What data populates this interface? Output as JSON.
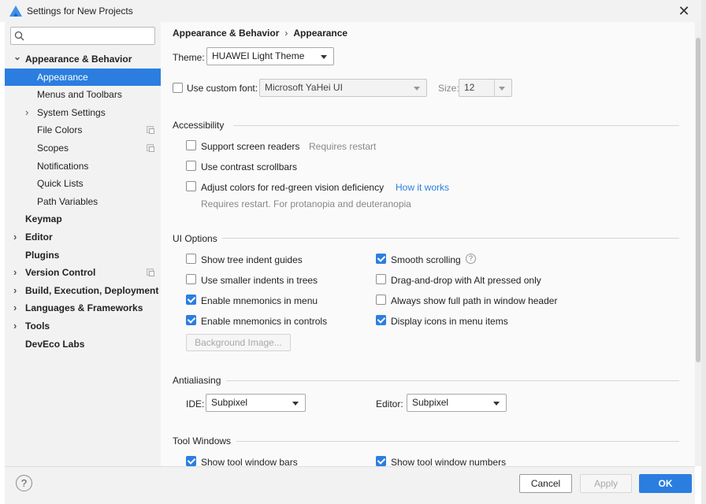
{
  "window": {
    "title": "Settings for New Projects"
  },
  "search": {
    "placeholder": "",
    "value": ""
  },
  "sidebar": {
    "items": [
      {
        "label": "Appearance & Behavior",
        "level": 0,
        "bold": true,
        "expanded": true
      },
      {
        "label": "Appearance",
        "level": 1,
        "selected": true
      },
      {
        "label": "Menus and Toolbars",
        "level": 1
      },
      {
        "label": "System Settings",
        "level": 1,
        "expandable": true
      },
      {
        "label": "File Colors",
        "level": 1,
        "project_icon": true
      },
      {
        "label": "Scopes",
        "level": 1,
        "project_icon": true
      },
      {
        "label": "Notifications",
        "level": 1
      },
      {
        "label": "Quick Lists",
        "level": 1
      },
      {
        "label": "Path Variables",
        "level": 1
      },
      {
        "label": "Keymap",
        "level": 0,
        "bold": true
      },
      {
        "label": "Editor",
        "level": 0,
        "bold": true,
        "expandable": true
      },
      {
        "label": "Plugins",
        "level": 0,
        "bold": true
      },
      {
        "label": "Version Control",
        "level": 0,
        "bold": true,
        "expandable": true,
        "project_icon": true
      },
      {
        "label": "Build, Execution, Deployment",
        "level": 0,
        "bold": true,
        "expandable": true
      },
      {
        "label": "Languages & Frameworks",
        "level": 0,
        "bold": true,
        "expandable": true
      },
      {
        "label": "Tools",
        "level": 0,
        "bold": true,
        "expandable": true
      },
      {
        "label": "DevEco Labs",
        "level": 0,
        "bold": true
      }
    ]
  },
  "breadcrumb": {
    "parent": "Appearance & Behavior",
    "separator": "›",
    "current": "Appearance"
  },
  "theme": {
    "label": "Theme:",
    "value": "HUAWEI Light Theme"
  },
  "font": {
    "checkbox_label": "Use custom font:",
    "checked": false,
    "value": "Microsoft YaHei UI",
    "size_label": "Size:",
    "size_value": "12"
  },
  "accessibility": {
    "title": "Accessibility",
    "screen_readers": {
      "label": "Support screen readers",
      "hint": "Requires restart",
      "checked": false
    },
    "contrast_scrollbars": {
      "label": "Use contrast scrollbars",
      "checked": false
    },
    "color_adjust": {
      "label": "Adjust colors for red-green vision deficiency",
      "link": "How it works",
      "note": "Requires restart. For protanopia and deuteranopia",
      "checked": false
    }
  },
  "ui_options": {
    "title": "UI Options",
    "left": [
      {
        "label": "Show tree indent guides",
        "checked": false
      },
      {
        "label": "Use smaller indents in trees",
        "checked": false
      },
      {
        "label": "Enable mnemonics in menu",
        "checked": true
      },
      {
        "label": "Enable mnemonics in controls",
        "checked": true
      }
    ],
    "right": [
      {
        "label": "Smooth scrolling",
        "checked": true,
        "help": true
      },
      {
        "label": "Drag-and-drop with Alt pressed only",
        "checked": false
      },
      {
        "label": "Always show full path in window header",
        "checked": false
      },
      {
        "label": "Display icons in menu items",
        "checked": true
      }
    ],
    "background_button": "Background Image..."
  },
  "antialiasing": {
    "title": "Antialiasing",
    "ide_label": "IDE:",
    "ide_value": "Subpixel",
    "editor_label": "Editor:",
    "editor_value": "Subpixel"
  },
  "tool_windows": {
    "title": "Tool Windows",
    "left": {
      "label": "Show tool window bars",
      "checked": true
    },
    "right": {
      "label": "Show tool window numbers",
      "checked": true
    }
  },
  "footer": {
    "help": "?",
    "cancel": "Cancel",
    "apply": "Apply",
    "ok": "OK"
  },
  "colors": {
    "accent": "#2b7ee0",
    "sidebar_bg": "#f2f2f2",
    "main_bg": "#fafafa"
  }
}
